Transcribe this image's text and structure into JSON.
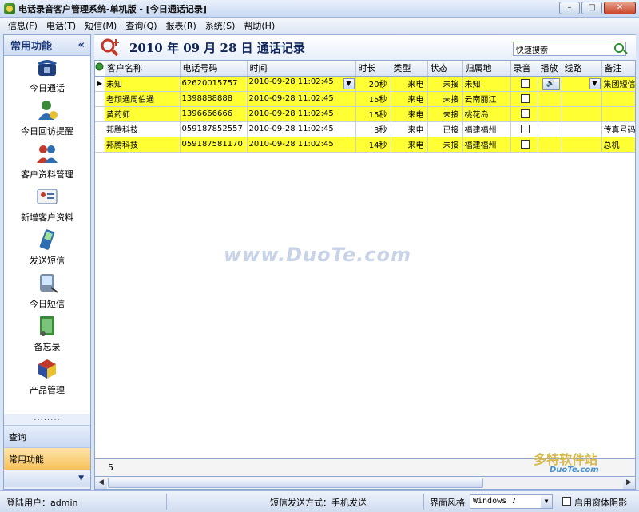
{
  "window": {
    "title": "电话录音客户管理系统-单机版 - [今日通话记录]",
    "minimize": "–",
    "maximize": "□",
    "close": "✕"
  },
  "menu": [
    "信息(F)",
    "电话(T)",
    "短信(M)",
    "查询(Q)",
    "报表(R)",
    "系统(S)",
    "帮助(H)"
  ],
  "sidebar": {
    "header": "常用功能",
    "collapse": "«",
    "items": [
      {
        "label": "今日通话",
        "icon": "telephone-icon"
      },
      {
        "label": "今日回访提醒",
        "icon": "user-reminder-icon"
      },
      {
        "label": "客户资料管理",
        "icon": "contacts-icon"
      },
      {
        "label": "新增客户资料",
        "icon": "contact-card-icon"
      },
      {
        "label": "发送短信",
        "icon": "mobile-phone-icon"
      },
      {
        "label": "今日短信",
        "icon": "pda-icon"
      },
      {
        "label": "备忘录",
        "icon": "notebook-icon"
      },
      {
        "label": "产品管理",
        "icon": "products-icon"
      }
    ],
    "dots": "........",
    "groups": [
      "查询",
      "常用功能"
    ],
    "bottom_arrow": "▼"
  },
  "header": {
    "title": "2010 年 09 月 28 日 通话记录",
    "search_value": "快速搜索"
  },
  "grid": {
    "columns": [
      "客户名称",
      "电话号码",
      "时间",
      "时长",
      "类型",
      "状态",
      "归属地",
      "录音",
      "播放",
      "线路",
      "备注"
    ],
    "rows": [
      {
        "name": "未知",
        "phone": "62620015757",
        "time": "2010-09-28 11:02:45",
        "duration": "20秒",
        "type": "来电",
        "status": "未接",
        "location": "未知",
        "note": "集团短信",
        "highlight": true,
        "current": true
      },
      {
        "name": "老顽通周伯通",
        "phone": "1398888888",
        "time": "2010-09-28 11:02:45",
        "duration": "15秒",
        "type": "来电",
        "status": "未接",
        "location": "云南丽江",
        "note": "",
        "highlight": true,
        "current": false
      },
      {
        "name": "黄药师",
        "phone": "1396666666",
        "time": "2010-09-28 11:02:45",
        "duration": "15秒",
        "type": "来电",
        "status": "未接",
        "location": "桃花岛",
        "note": "",
        "highlight": true,
        "current": false
      },
      {
        "name": "邦腾科技",
        "phone": "059187852557",
        "time": "2010-09-28 11:02:45",
        "duration": "3秒",
        "type": "来电",
        "status": "已接",
        "location": "福建福州",
        "note": "传真号码",
        "highlight": false,
        "current": false
      },
      {
        "name": "邦腾科技",
        "phone": "059187581170",
        "time": "2010-09-28 11:02:45",
        "duration": "14秒",
        "type": "来电",
        "status": "未接",
        "location": "福建福州",
        "note": "总机",
        "highlight": true,
        "current": false
      }
    ],
    "row_count": "5"
  },
  "watermark": "www.DuoTe.com",
  "corner_watermark": "多特软件站",
  "corner_watermark2": "DuoTe.com",
  "status": {
    "user": "登陆用户：admin",
    "sms_mode": "短信发送方式：手机发送",
    "theme_label": "界面风格",
    "theme_value": "Windows 7",
    "shadow_label": "启用窗体阴影"
  },
  "colors": {
    "highlight_row": "#ffff33",
    "accent": "#1c3a7a"
  }
}
